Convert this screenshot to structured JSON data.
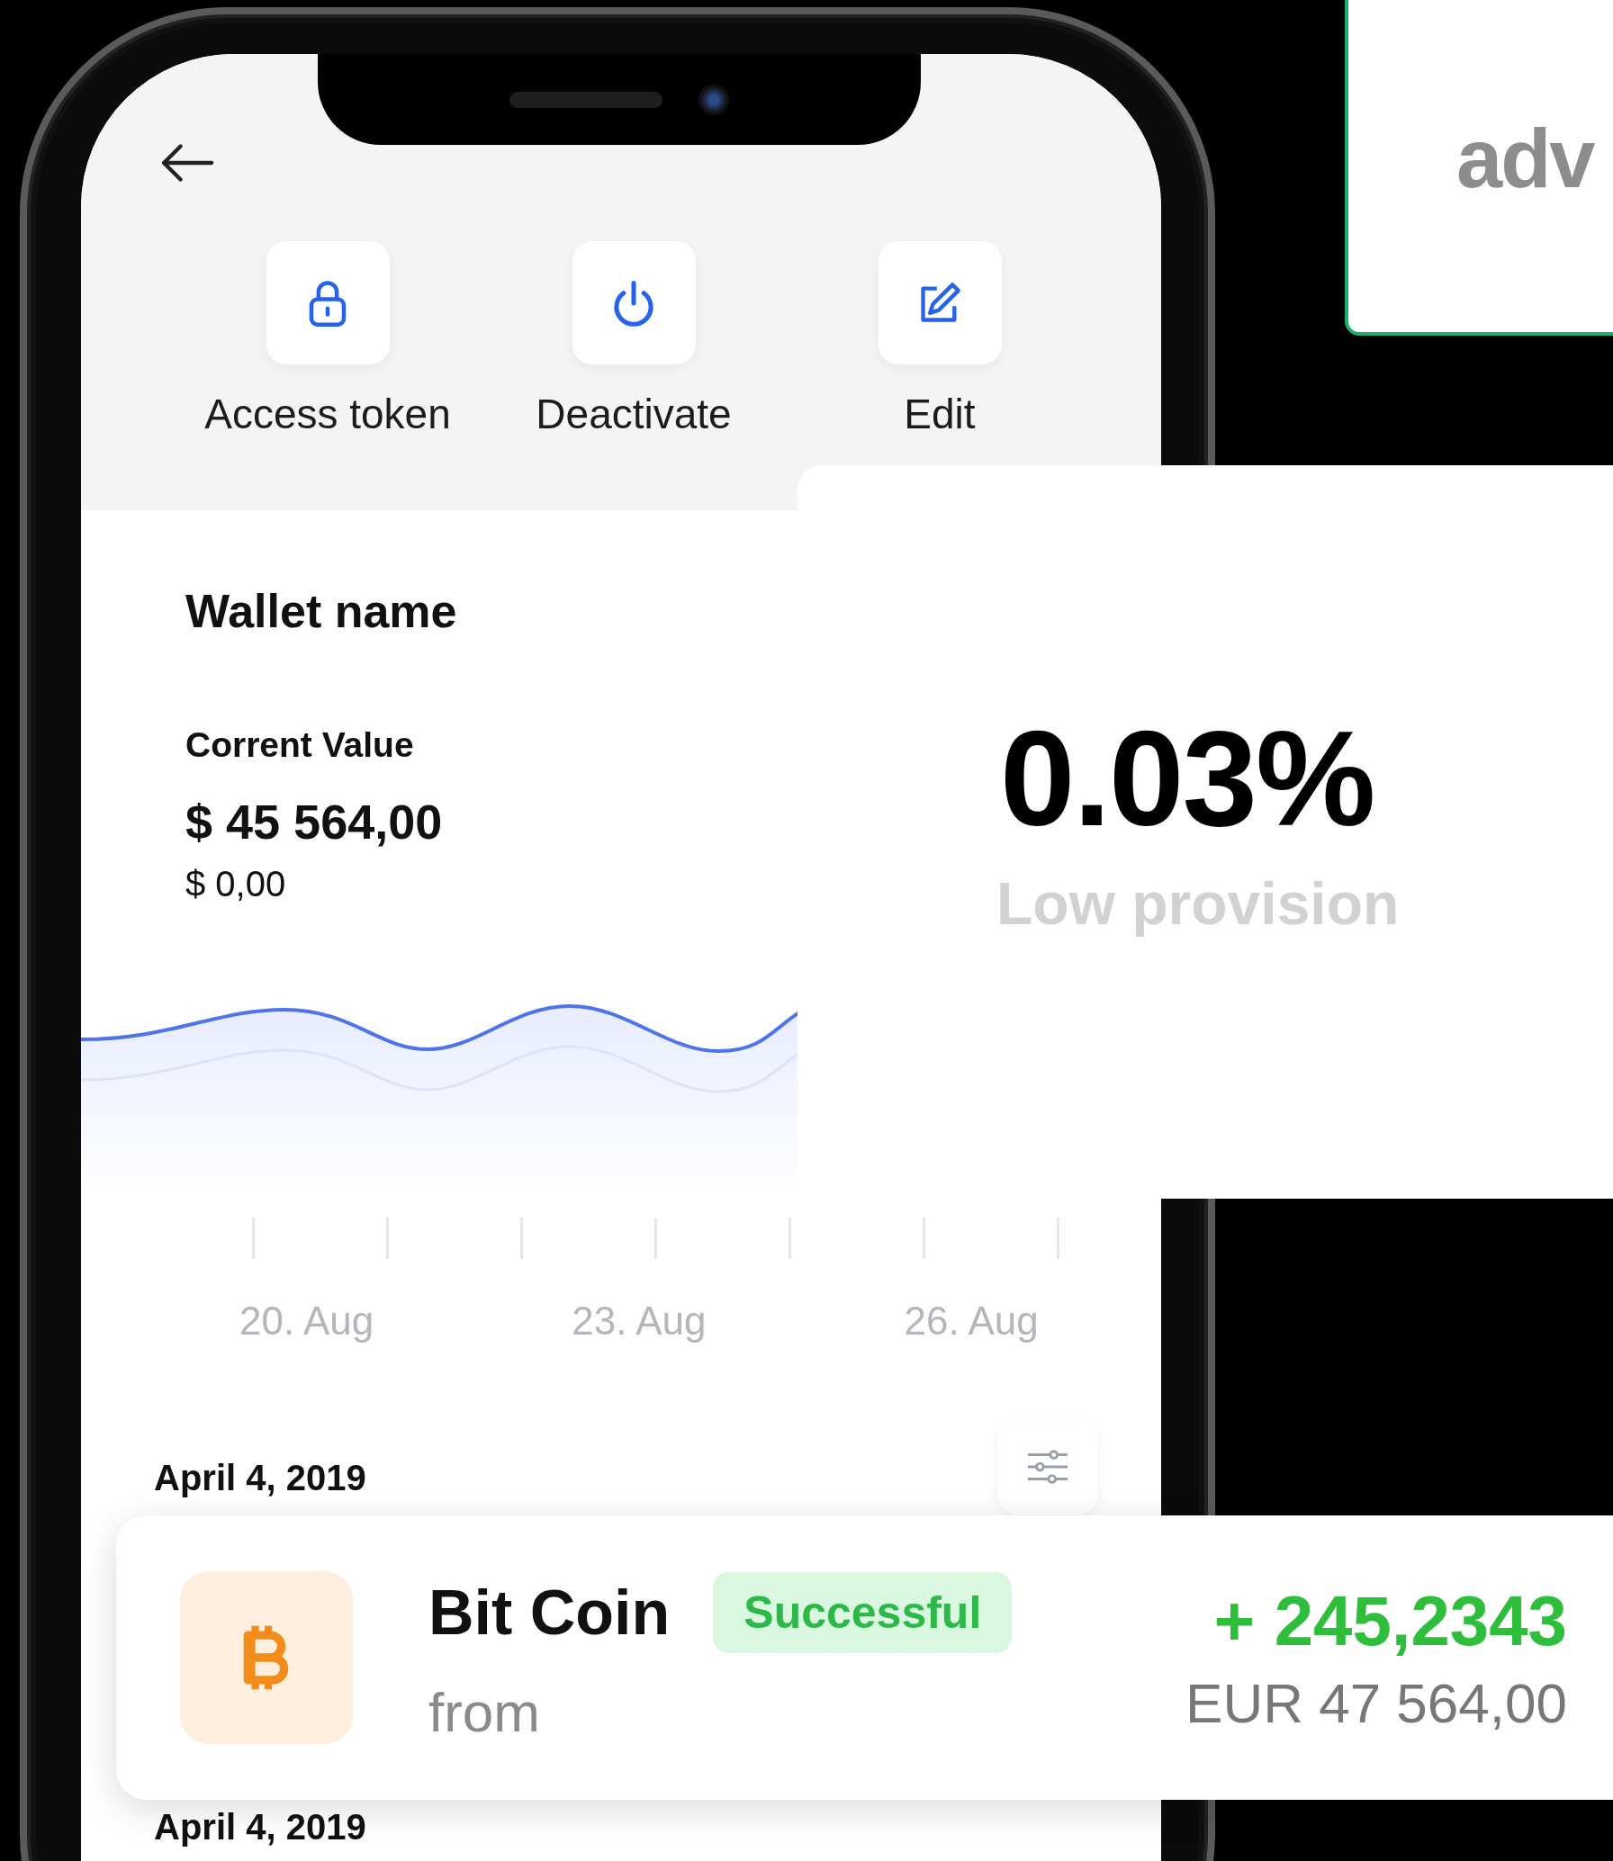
{
  "actions": [
    {
      "kind": "lock",
      "label": "Access token"
    },
    {
      "kind": "power",
      "label": "Deactivate"
    },
    {
      "kind": "edit",
      "label": "Edit"
    }
  ],
  "wallet": {
    "name": "Wallet name",
    "value_label": "Corrent Value",
    "value": "$ 45 564,00",
    "change": "$ 0,00"
  },
  "chart": {
    "x_labels": [
      "20. Aug",
      "23. Aug",
      "26. Aug"
    ]
  },
  "dates": [
    "April 4, 2019",
    "April 4, 2019"
  ],
  "transaction_card": {
    "name": "Bit Coin",
    "status": "Successful",
    "subtitle": "from",
    "amount": "+ 245,2343",
    "fiat": "EUR 47 564,00"
  },
  "provision_card": {
    "value": "0.03%",
    "label": "Low provision"
  },
  "logo_card": {
    "text": "adv"
  }
}
